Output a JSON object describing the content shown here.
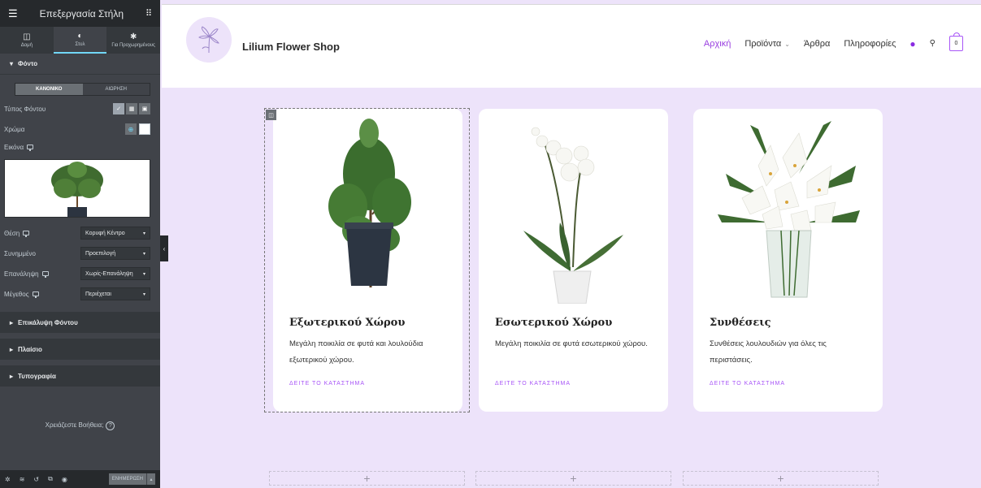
{
  "panel": {
    "title": "Επεξεργασία Στήλη",
    "tabs": [
      {
        "label": "Δομή",
        "icon": "layout-icon"
      },
      {
        "label": "Στυλ",
        "icon": "contrast-icon"
      },
      {
        "label": "Για Προχωρημένους",
        "icon": "gear-icon"
      }
    ],
    "section_background": "Φόντο",
    "state_tabs": [
      "ΚΑΝΟΝΙΚΟ",
      "ΑΙΩΡΗΣΗ"
    ],
    "background_type_label": "Τύπος Φόντου",
    "color_label": "Χρώμα",
    "image_label": "Εικόνα",
    "position_label": "Θέση",
    "position_value": "Κορυφή Κέντρο",
    "attachment_label": "Συνημμένο",
    "attachment_value": "Προεπιλογή",
    "repeat_label": "Επανάληψη",
    "repeat_value": "Χωρίς-Επανάληψη",
    "size_label": "Μέγεθος",
    "size_value": "Περιέχεται",
    "section_overlay": "Επικάλυψη Φόντου",
    "section_border": "Πλαίσιο",
    "section_typography": "Τυπογραφία",
    "help_text": "Χρειάζεστε Βοήθεια;",
    "update_button": "ΕΝΗΜΕΡΩΣΗ"
  },
  "site": {
    "title": "Lilium Flower Shop",
    "nav": {
      "home": "Αρχική",
      "products": "Προϊόντα",
      "articles": "Άρθρα",
      "info": "Πληροφορίες"
    },
    "cart_count": "0"
  },
  "cards": [
    {
      "title": "Εξωτερικού Χώρου",
      "desc": "Μεγάλη ποικιλία σε φυτά και λουλούδια εξωτερικού χώρου.",
      "link": "ΔΕΙΤΕ ΤΟ ΚΑΤΑΣΤΗΜΑ"
    },
    {
      "title": "Εσωτερικού Χώρου",
      "desc": "Μεγάλη ποικιλία σε φυτά εσωτερικού χώρου.",
      "link": "ΔΕΙΤΕ ΤΟ ΚΑΤΑΣΤΗΜΑ"
    },
    {
      "title": "Συνθέσεις",
      "desc": "Συνθέσεις λουλουδιών για όλες τις περιστάσεις.",
      "link": "ΔΕΙΤΕ ΤΟ ΚΑΤΑΣΤΗΜΑ"
    }
  ],
  "colors": {
    "accent": "#a855f7",
    "canvas_bg": "#ede3fa",
    "panel_bg": "#404349"
  }
}
